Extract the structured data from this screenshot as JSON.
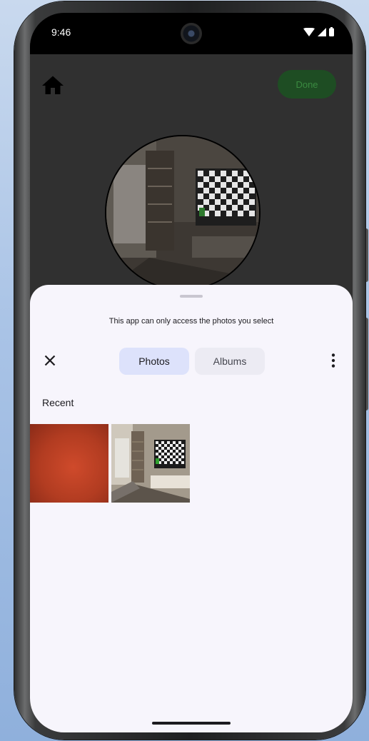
{
  "status_bar": {
    "time": "9:46"
  },
  "app": {
    "done_label": "Done"
  },
  "sheet": {
    "notice": "This app can only access the photos you select",
    "tabs": [
      {
        "label": "Photos",
        "selected": true
      },
      {
        "label": "Albums",
        "selected": false
      }
    ],
    "section_title": "Recent",
    "photos": [
      {
        "name": "red-texture"
      },
      {
        "name": "living-room-tv"
      }
    ]
  },
  "colors": {
    "done_button": "#1e4d23",
    "sheet_background": "#f7f5fc",
    "selected_tab": "#dde2fb"
  }
}
